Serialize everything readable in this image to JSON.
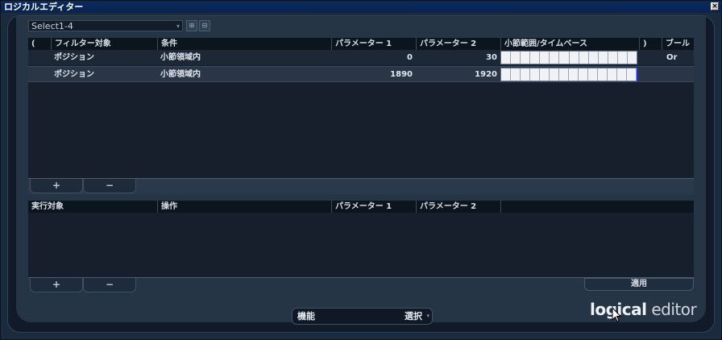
{
  "window": {
    "title": "ロジカルエディター",
    "close": "×"
  },
  "preset": {
    "name": "Select1-4",
    "arrow": "▾"
  },
  "filter": {
    "headers": [
      "(",
      "フィルター対象",
      "条件",
      "パラメーター 1",
      "パラメーター 2",
      "小節範囲/タイムベース",
      ")",
      "ブール"
    ],
    "rows": [
      {
        "target": "ポジション",
        "condition": "小節領域内",
        "p1": "0",
        "p2": "30",
        "bool": "Or"
      },
      {
        "target": "ポジション",
        "condition": "小節領域内",
        "p1": "1890",
        "p2": "1920",
        "bool": ""
      }
    ],
    "add": "+",
    "remove": "−"
  },
  "action": {
    "headers": [
      "実行対象",
      "操作",
      "パラメーター 1",
      "パラメーター 2"
    ],
    "add": "+",
    "remove": "−"
  },
  "apply_label": "適用",
  "function": {
    "label": "機能",
    "value": "選択",
    "arrow": "▾"
  },
  "logo": {
    "bold": "logical",
    "light": " editor"
  }
}
